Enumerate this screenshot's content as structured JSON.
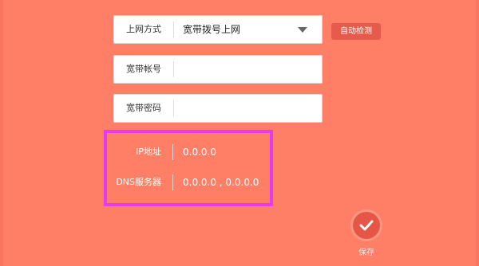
{
  "form": {
    "connection_type": {
      "label": "上网方式",
      "value": "宽带拨号上网"
    },
    "auto_detect_label": "自动检测",
    "account": {
      "label": "宽带帐号",
      "value": ""
    },
    "password": {
      "label": "宽带密码",
      "value": ""
    }
  },
  "status": {
    "ip": {
      "label": "IP地址",
      "value": "0.0.0.0"
    },
    "dns": {
      "label": "DNS服务器",
      "value": "0.0.0.0 , 0.0.0.0"
    }
  },
  "save": {
    "label": "保存"
  },
  "colors": {
    "background": "#ff7f66",
    "highlight": "#e83bf0",
    "button": "#e65646"
  },
  "icons": {
    "dropdown": "chevron-down-icon",
    "save": "check-icon"
  }
}
